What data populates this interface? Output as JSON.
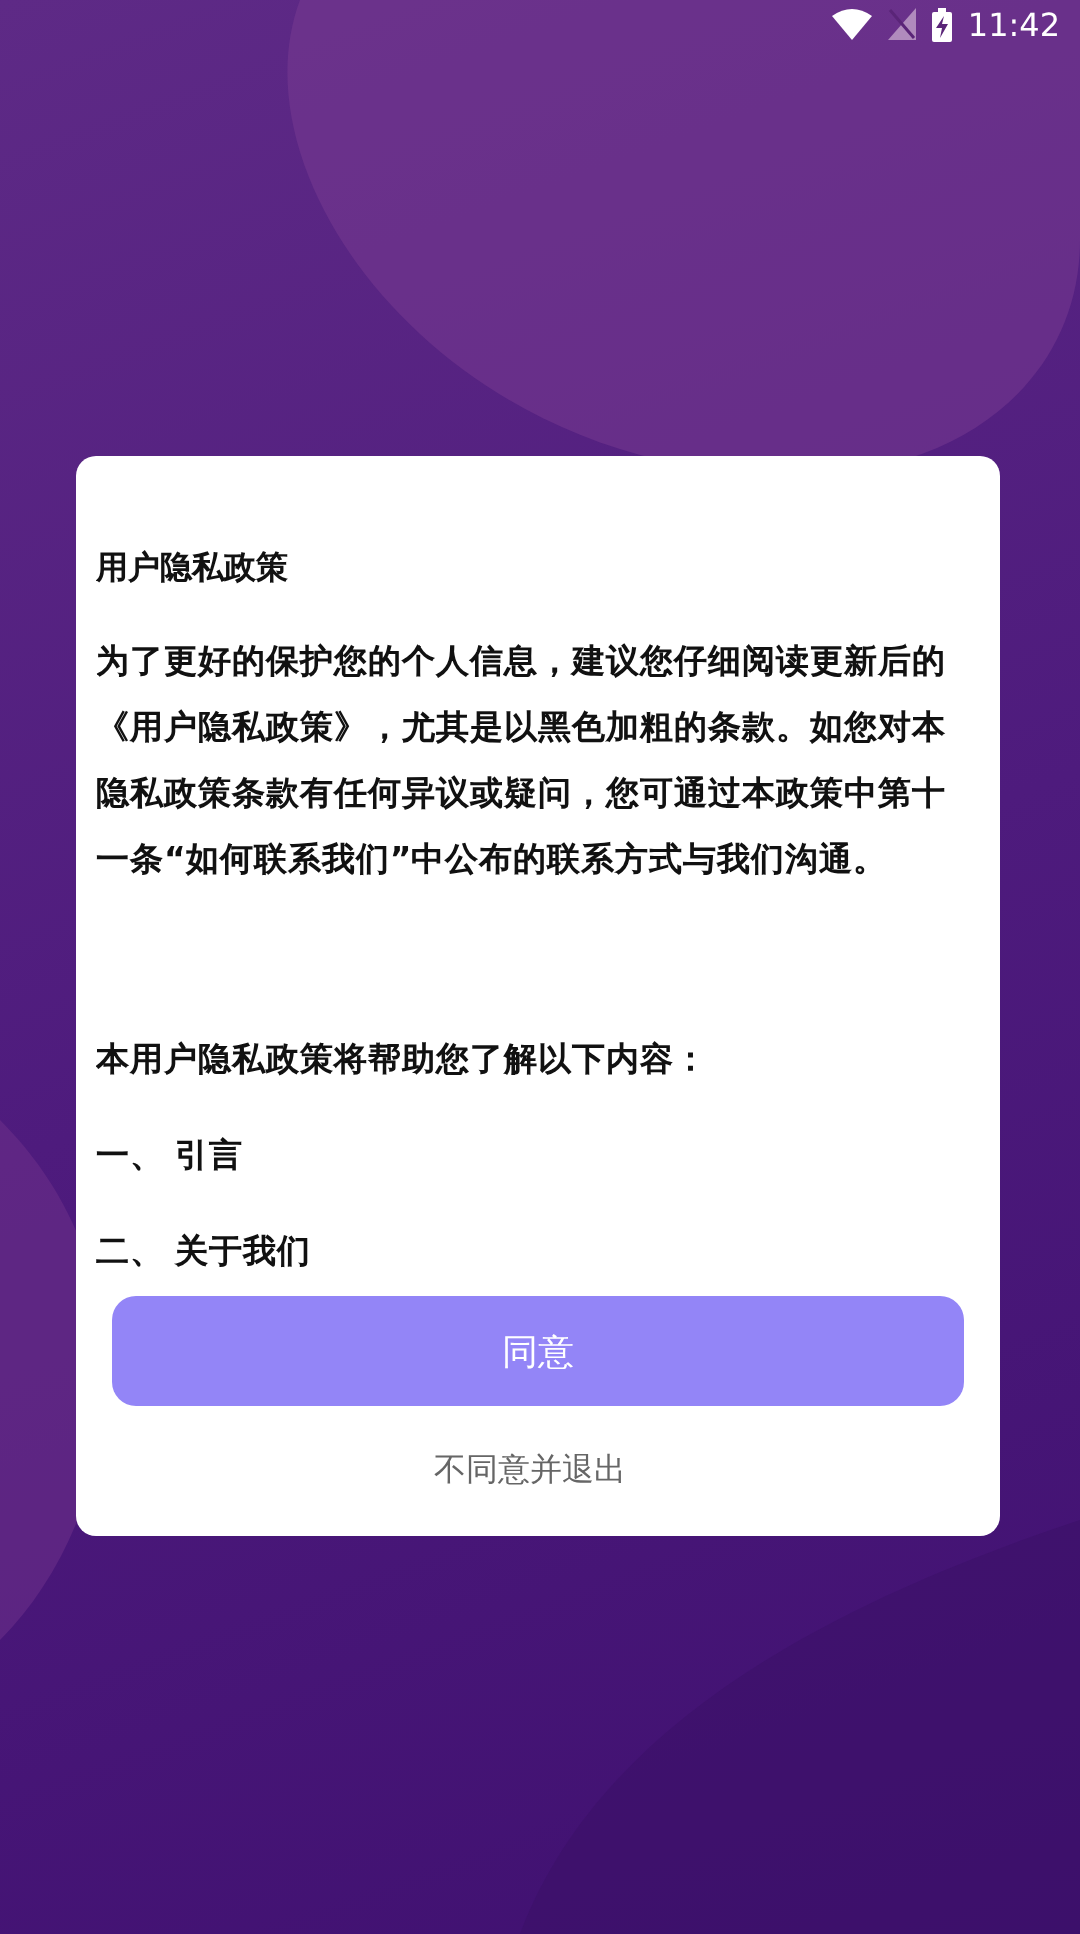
{
  "status_bar": {
    "time": "11:42"
  },
  "dialog": {
    "title": "用户隐私政策",
    "paragraph": "为了更好的保护您的个人信息，建议您仔细阅读更新后的《用户隐私政策》，尤其是以黑色加粗的条款。如您对本隐私政策条款有任何异议或疑问，您可通过本政策中第十一条“如何联系我们”中公布的联系方式与我们沟通。",
    "intro": "本用户隐私政策将帮助您了解以下内容：",
    "sections": [
      "一、 引言",
      "二、 关于我们"
    ],
    "agree_button": "同意",
    "decline_link": "不同意并退出"
  }
}
